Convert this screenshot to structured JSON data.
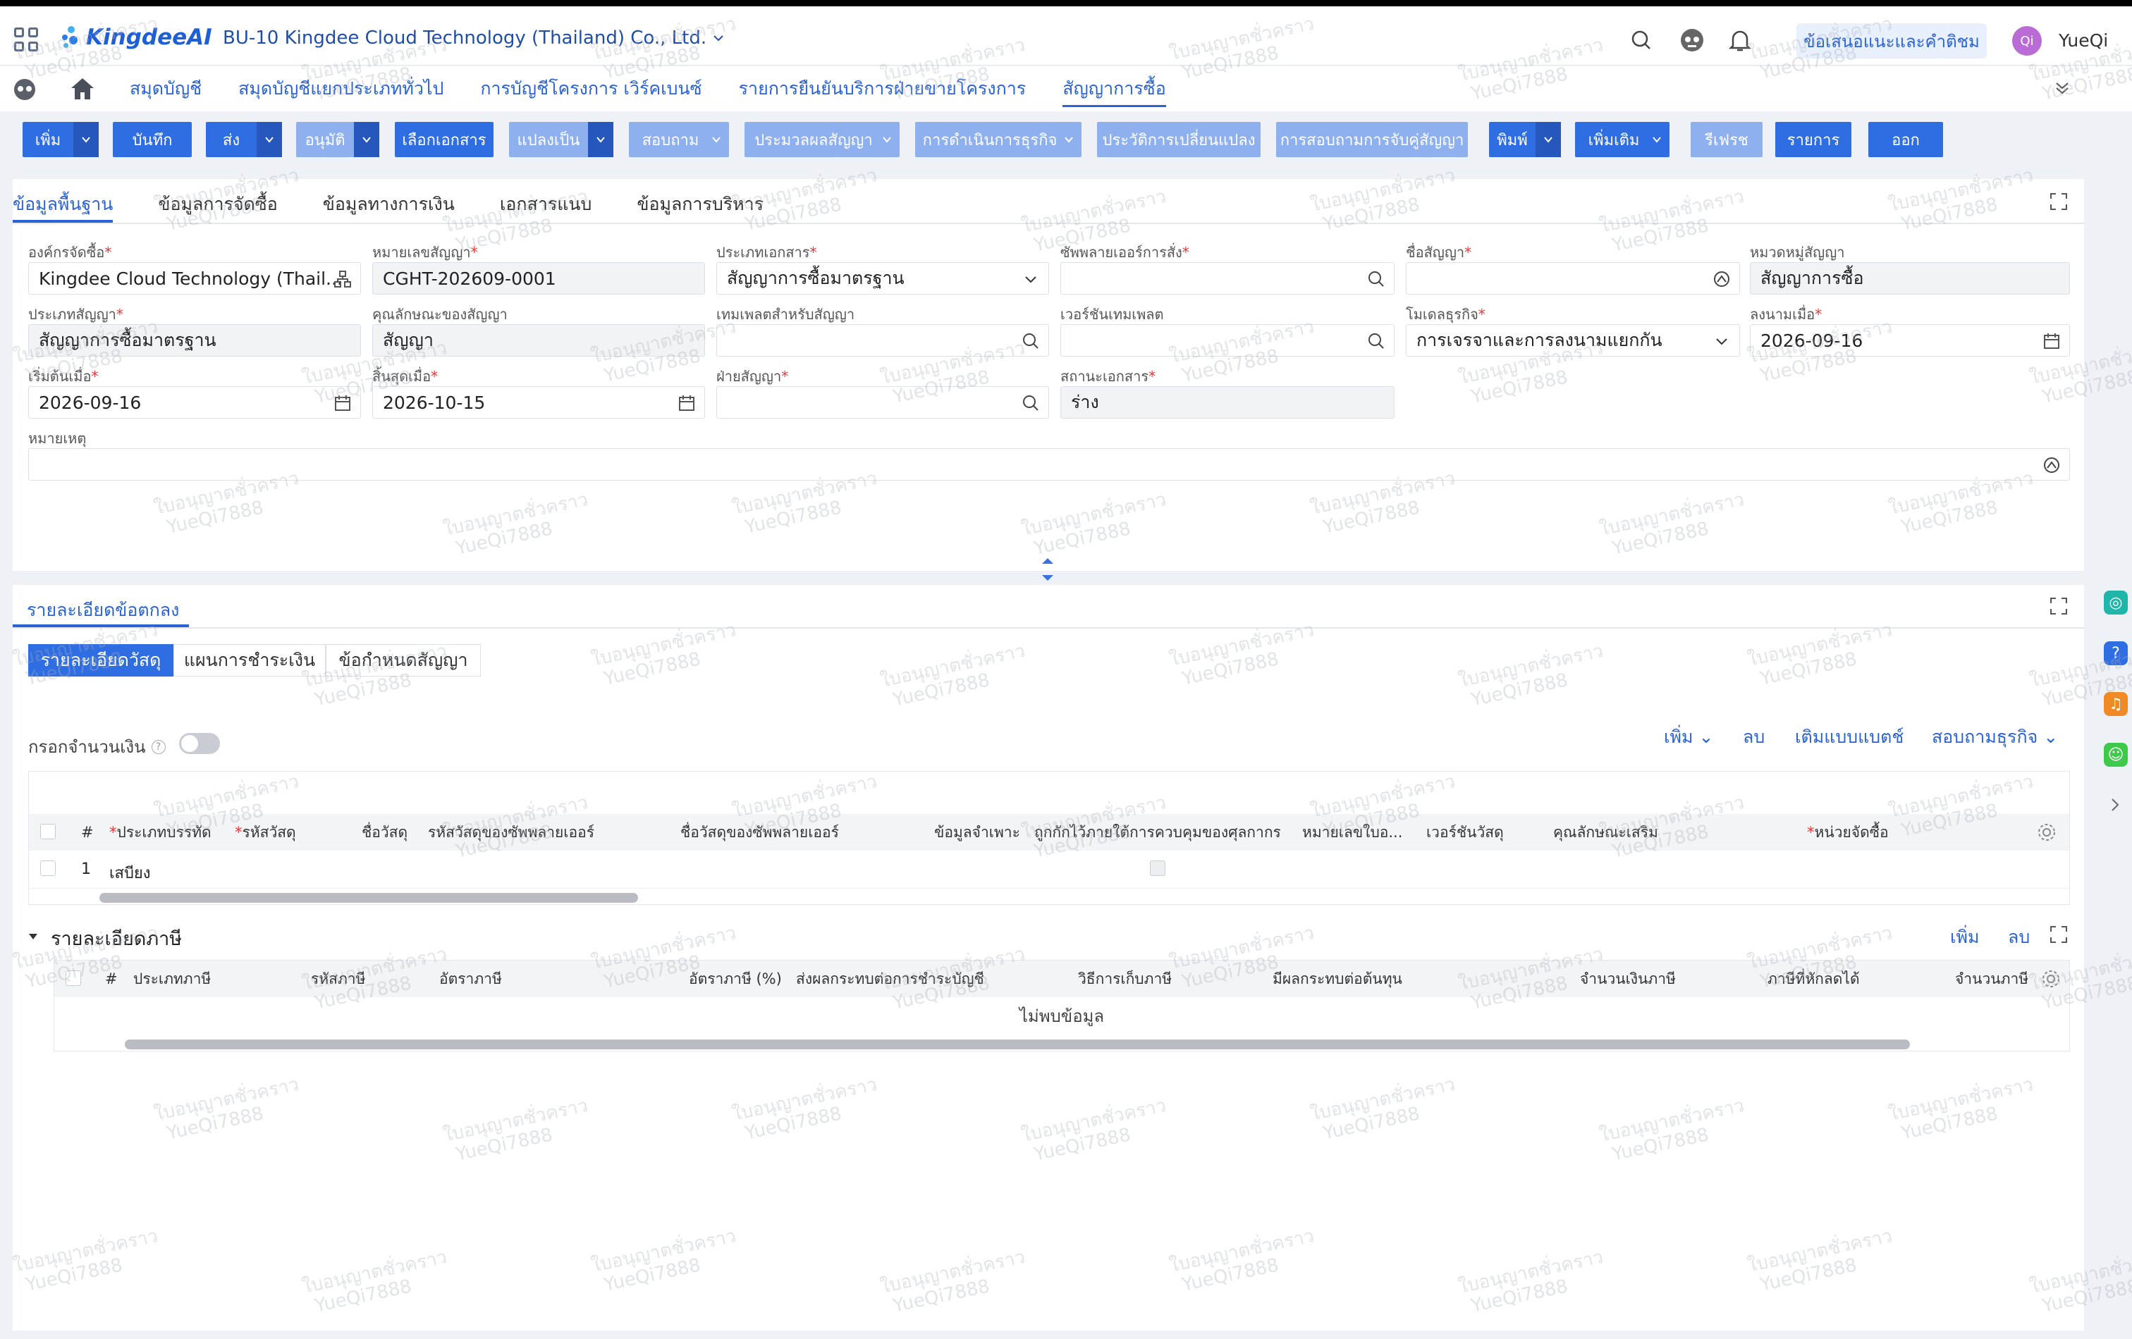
{
  "topbar": {
    "brand": "KingdeeAI",
    "company": "BU-10 Kingdee Cloud Technology (Thailand) Co., Ltd.",
    "suggest_label": "ข้อเสนอแนะและคำติชม",
    "avatar_initials": "Qi",
    "username": "YueQi"
  },
  "nav": {
    "items": [
      "สมุดบัญชี",
      "สมุดบัญชีแยกประเภททั่วไป",
      "การบัญชีโครงการ เวิร์คเบนซ์",
      "รายการยืนยันบริการฝ่ายขายโครงการ",
      "สัญญาการซื้อ"
    ]
  },
  "toolbar": {
    "buttons": [
      "เพิ่ม",
      "บันทึก",
      "ส่ง",
      "อนุมัติ",
      "เลือกเอกสาร",
      "แปลงเป็น",
      "สอบถาม",
      "ประมวลผลสัญญา",
      "การดำเนินการธุรกิจ",
      "ประวัติการเปลี่ยนแปลง",
      "การสอบถามการจับคู่สัญญา",
      "พิมพ์",
      "เพิ่มเติม",
      "รีเฟรช",
      "รายการ",
      "ออก"
    ]
  },
  "header_tabs": [
    "ข้อมูลพื้นฐาน",
    "ข้อมูลการจัดซื้อ",
    "ข้อมูลทางการเงิน",
    "เอกสารแนบ",
    "ข้อมูลการบริหาร"
  ],
  "form": {
    "org_label": "องค์กรจัดซื้อ",
    "org_value": "Kingdee Cloud Technology (Thail...",
    "contract_no_label": "หมายเลขสัญญา",
    "contract_no_value": "CGHT-202609-0001",
    "doc_type_label": "ประเภทเอกสาร",
    "doc_type_value": "สัญญาการซื้อมาตรฐาน",
    "supplier_label": "ซัพพลายเออร์การสั่ง",
    "supplier_value": "",
    "contract_name_label": "ชื่อสัญญา",
    "contract_name_value": "",
    "category_label": "หมวดหมู่สัญญา",
    "category_value": "สัญญาการซื้อ",
    "contract_type_label": "ประเภทสัญญา",
    "contract_type_value": "สัญญาการซื้อมาตรฐาน",
    "nature_label": "คุณลักษณะของสัญญา",
    "nature_value": "สัญญา",
    "template_label": "เทมเพลตสำหรับสัญญา",
    "template_value": "",
    "template_ver_label": "เวอร์ชันเทมเพลต",
    "template_ver_value": "",
    "biz_model_label": "โมเดลธุรกิจ",
    "biz_model_value": "การเจรจาและการลงนามแยกกัน",
    "signed_label": "ลงนามเมื่อ",
    "signed_value": "2026-09-16",
    "start_label": "เริ่มต้นเมื่อ",
    "start_value": "2026-09-16",
    "end_label": "สิ้นสุดเมื่อ",
    "end_value": "2026-10-15",
    "party_label": "ฝ่ายสัญญา",
    "party_value": "",
    "status_label": "สถานะเอกสาร",
    "status_value": "ร่าง",
    "remark_label": "หมายเหตุ",
    "remark_value": ""
  },
  "details": {
    "title": "รายละเอียดข้อตกลง",
    "subtabs": [
      "รายละเอียดวัสดุ",
      "แผนการชำระเงิน",
      "ข้อกำหนดสัญญา"
    ],
    "amount_toggle_label": "กรอกจำนวนเงิน",
    "actions": [
      "เพิ่ม",
      "ลบ",
      "เติมแบบแบตช์",
      "สอบถามธุรกิจ"
    ],
    "columns": [
      "#",
      "ประเภทบรรทัด",
      "รหัสวัสดุ",
      "ชื่อวัสดุ",
      "รหัสวัสดุของซัพพลายเออร์",
      "ชื่อวัสดุของซัพพลายเออร์",
      "ข้อมูลจำเพาะ",
      "ถูกกักไว้ภายใต้การควบคุมของศุลกากร",
      "หมายเลขใบอ...",
      "เวอร์ชันวัสดุ",
      "คุณลักษณะเสริม",
      "หน่วยจัดซื้อ"
    ],
    "rows": [
      {
        "no": "1",
        "line_type": "เสบียง"
      }
    ]
  },
  "tax": {
    "title": "รายละเอียดภาษี",
    "actions": [
      "เพิ่ม",
      "ลบ"
    ],
    "columns": [
      "#",
      "ประเภทภาษี",
      "รหัสภาษี",
      "อัตราภาษี",
      "อัตราภาษี (%)",
      "ส่งผลกระทบต่อการชำระบัญชี",
      "วิธีการเก็บภาษี",
      "มีผลกระทบต่อต้นทุน",
      "จำนวนเงินภาษี",
      "ภาษีที่หักลดได้",
      "จำนวนภาษี"
    ],
    "empty_text": "ไม่พบข้อมูล"
  },
  "watermark": {
    "line1": "ใบอนุญาตชั่วคราว",
    "line2": "YueQi7888"
  },
  "colors": {
    "primary": "#2f6de2",
    "link": "#2a63d6",
    "required": "#ee3333"
  }
}
